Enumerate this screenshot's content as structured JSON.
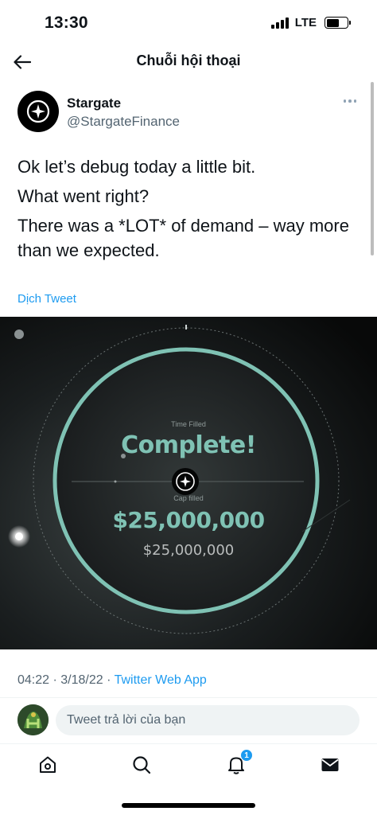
{
  "status_bar": {
    "time": "13:30",
    "network": "LTE"
  },
  "header": {
    "title": "Chuỗi hội thoại",
    "back_icon": "arrow-left-icon"
  },
  "tweet": {
    "author_name": "Stargate",
    "author_handle": "@StargateFinance",
    "lines": [
      "Ok let’s debug today a little bit.",
      "What went right?",
      "There was a *LOT* of demand – way more than we expected."
    ],
    "translate_label": "Dịch Tweet",
    "media": {
      "time_label": "Time Filled",
      "status": "Complete!",
      "cap_label": "Cap filled",
      "amount": "$25,000,000",
      "amount_total": "$25,000,000",
      "accent_color": "#7fc2b4"
    },
    "time": "04:22",
    "date": "3/18/22",
    "separator": " · ",
    "source": "Twitter Web App"
  },
  "reply": {
    "placeholder": "Tweet trả lời của bạn"
  },
  "nav": {
    "items": [
      "home-icon",
      "search-icon",
      "bell-icon",
      "mail-icon"
    ],
    "notification_count": "1"
  },
  "colors": {
    "link": "#1d9bf0",
    "secondary_text": "#536471"
  }
}
